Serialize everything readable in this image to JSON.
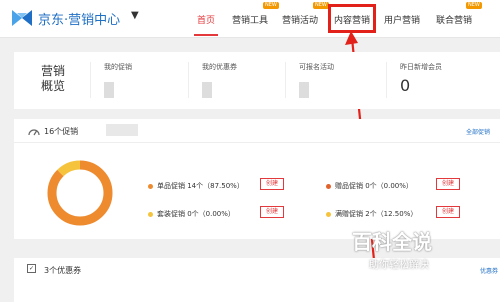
{
  "header": {
    "logo_text": "京东·营销中心",
    "logo_caret": "▼",
    "nav": [
      {
        "label": "首页",
        "active": true
      },
      {
        "label": "营销工具",
        "badge": "NEW"
      },
      {
        "label": "营销活动",
        "badge": "NEW"
      },
      {
        "label": "内容营销"
      },
      {
        "label": "用户营销"
      },
      {
        "label": "联合营销",
        "badge": "NEW"
      }
    ],
    "accent_color": "#e4393c",
    "highlight_color": "#e2221a"
  },
  "stats": {
    "title": "营销概览",
    "items": [
      {
        "label": "我的促销"
      },
      {
        "label": "我的优惠券"
      },
      {
        "label": "可报名活动"
      },
      {
        "label": "昨日新增会员",
        "value": "0"
      }
    ]
  },
  "promotions": {
    "title": "16个促销",
    "all_link": "全部促销",
    "legend": [
      {
        "label": "单品促销 14个（87.50%）",
        "color": "#ee8b2e",
        "action": "创建"
      },
      {
        "label": "赠品促销 0个（0.00%）",
        "color": "#e2622b",
        "action": "创建"
      },
      {
        "label": "套装促销 0个（0.00%）",
        "color": "#f6c33c",
        "action": "创建"
      },
      {
        "label": "满赠促销 2个（12.50%）",
        "color": "#f6c33c",
        "action": "创建"
      }
    ]
  },
  "coupons": {
    "title": "3个优惠券",
    "link": "优惠券"
  },
  "watermark": {
    "title": "百科全说",
    "subtitle": "助你轻松解决"
  }
}
